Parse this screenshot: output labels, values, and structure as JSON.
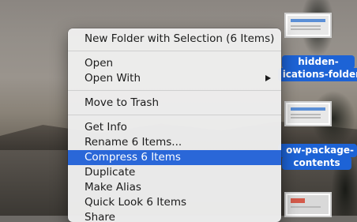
{
  "menu": {
    "items": [
      {
        "label": "New Folder with Selection (6 Items)"
      },
      {
        "label": "Open"
      },
      {
        "label": "Open With",
        "icon": "chevron-right-icon"
      },
      {
        "label": "Move to Trash"
      },
      {
        "label": "Get Info"
      },
      {
        "label": "Rename 6 Items..."
      },
      {
        "label": "Compress 6 Items",
        "highlighted": true
      },
      {
        "label": "Duplicate"
      },
      {
        "label": "Make Alias"
      },
      {
        "label": "Quick Look 6 Items"
      },
      {
        "label": "Share"
      }
    ]
  },
  "desktop": {
    "files": [
      {
        "label_lines": [
          "hidden-",
          "ications-folder"
        ]
      },
      {
        "label_lines": [
          "ow-package-",
          "contents"
        ]
      }
    ]
  },
  "colors": {
    "highlight": "#2a67d8",
    "selection_label": "#1d63d6"
  }
}
